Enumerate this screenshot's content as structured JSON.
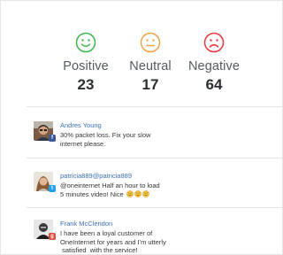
{
  "summary": [
    {
      "key": "positive",
      "label": "Positive",
      "count": "23",
      "color": "#3bb54a"
    },
    {
      "key": "neutral",
      "label": "Neutral",
      "count": "17",
      "color": "#f0a24a"
    },
    {
      "key": "negative",
      "label": "Negative",
      "count": "64",
      "color": "#e8353a"
    }
  ],
  "posts": [
    {
      "author": "Andres Young",
      "text_lines": [
        "30% packet loss. Fix your  slow",
        "internet please."
      ],
      "source": "facebook",
      "source_icon": "facebook-icon",
      "source_color": "#3b5998"
    },
    {
      "author": "patricia889@patricia889",
      "text_lines": [
        "@oneinternet Half an hour to load",
        "5 minutes video!  Nice"
      ],
      "source": "twitter",
      "source_icon": "twitter-icon",
      "source_color": "#1da1f2",
      "emoji": [
        "angry-face-emoji",
        "angry-face-emoji",
        "angry-face-emoji"
      ]
    },
    {
      "author": "Frank McClendon",
      "text_lines": [
        "I have been a loyal customer of",
        "OneInternet for years and I'm utterly",
        " satisfied  with the service!"
      ],
      "source": "google-plus",
      "source_icon": "google-plus-icon",
      "source_color": "#dd4b39"
    }
  ]
}
